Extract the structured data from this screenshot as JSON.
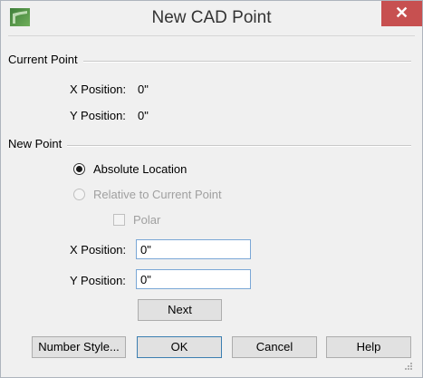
{
  "window": {
    "title": "New CAD Point",
    "close_label": "✕",
    "app_icon": "cad-app-icon"
  },
  "current_point": {
    "group_label": "Current Point",
    "x_label": "X Position:",
    "x_value": "0\"",
    "y_label": "Y Position:",
    "y_value": "0\""
  },
  "new_point": {
    "group_label": "New Point",
    "absolute_label": "Absolute Location",
    "relative_label": "Relative to Current Point",
    "polar_label": "Polar",
    "x_label": "X Position:",
    "x_value": "0\"",
    "y_label": "Y Position:",
    "y_value": "0\"",
    "next_label": "Next"
  },
  "buttons": {
    "number_style": "Number Style...",
    "ok": "OK",
    "cancel": "Cancel",
    "help": "Help"
  },
  "colors": {
    "close_button": "#c75050",
    "input_border": "#7aa7d6",
    "default_button_border": "#3c7fb1"
  }
}
